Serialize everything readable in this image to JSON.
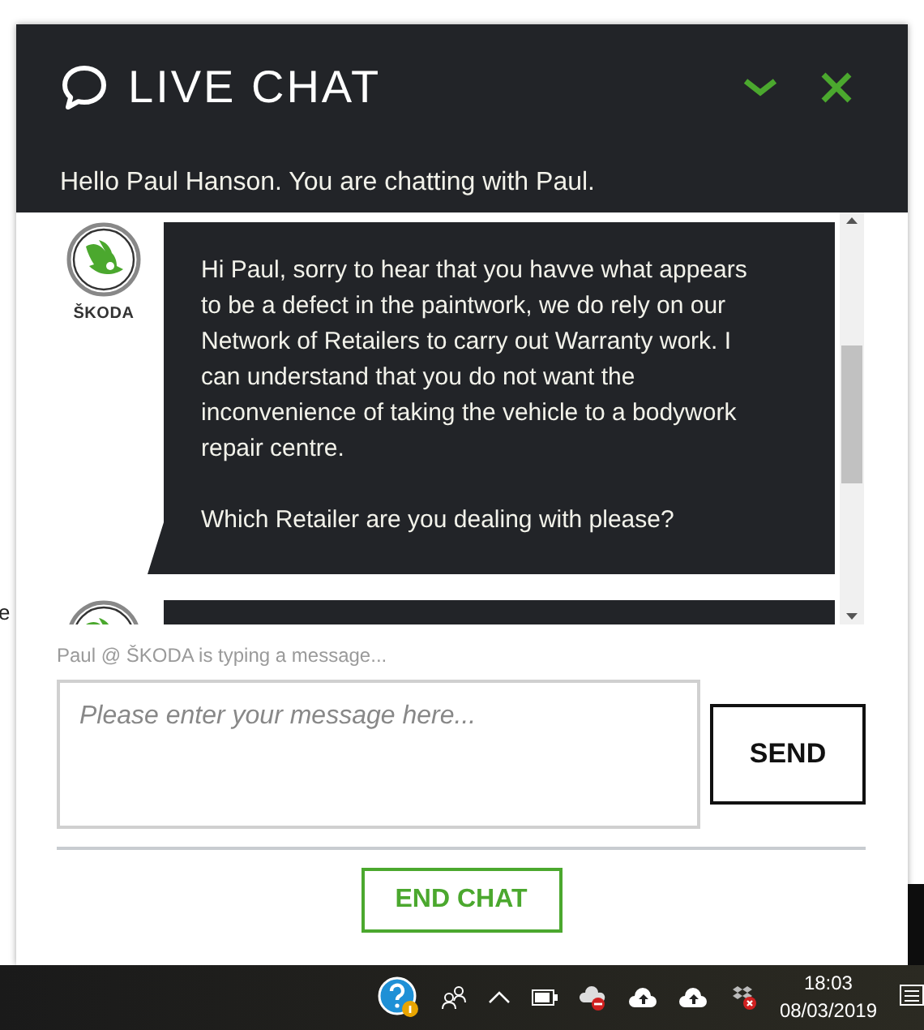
{
  "background_text": "e",
  "header": {
    "title": "LIVE CHAT",
    "greeting": "Hello Paul Hanson. You are chatting with Paul."
  },
  "messages": [
    {
      "kind": "agent",
      "brand": "ŠKODA",
      "paragraphs": [
        "Hi Paul, sorry to hear that you havve what appears to be a defect in the paintwork, we do rely on our Network of Retailers to carry out Warranty work. I can understand that you do not want the inconvenience of taking the vehicle to a bodywork repair centre.",
        "Which Retailer are you dealing with please?"
      ]
    },
    {
      "kind": "clipped"
    }
  ],
  "typing_status": "Paul @ ŠKODA is typing a message...",
  "composer": {
    "placeholder": "Please enter your message here...",
    "send": "SEND"
  },
  "end_chat": "END CHAT",
  "taskbar": {
    "time": "18:03",
    "date": "08/03/2019"
  }
}
